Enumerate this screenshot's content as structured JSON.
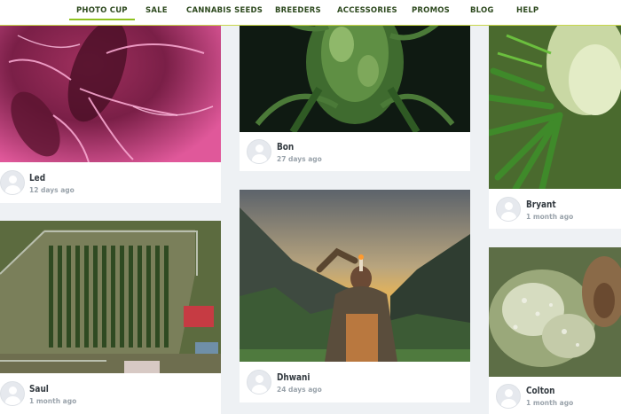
{
  "nav": {
    "items": [
      {
        "label": "PHOTO CUP",
        "active": true
      },
      {
        "label": "SALE"
      },
      {
        "label": "CANNABIS SEEDS"
      },
      {
        "label": "BREEDERS"
      },
      {
        "label": "ACCESSORIES"
      },
      {
        "label": "PROMOS"
      },
      {
        "label": "BLOG"
      },
      {
        "label": "HELP"
      }
    ]
  },
  "posts": [
    {
      "author": "Led",
      "age": "12 days ago",
      "photo": "pink flower close-up"
    },
    {
      "author": "Saul",
      "age": "1 month ago",
      "photo": "aerial view of grow field"
    },
    {
      "author": "Bon",
      "age": "27 days ago",
      "photo": "green bud on plant"
    },
    {
      "author": "Dhwani",
      "age": "24 days ago",
      "photo": "man in mountain valley"
    },
    {
      "author": "Bryant",
      "age": "1 month ago",
      "photo": "cannabis leaves"
    },
    {
      "author": "Colton",
      "age": "1 month ago",
      "photo": "frosty bud macro"
    }
  ],
  "colors": {
    "accent": "#8fc31f",
    "nav_text": "#2e4a1f",
    "background": "#eef1f4"
  }
}
